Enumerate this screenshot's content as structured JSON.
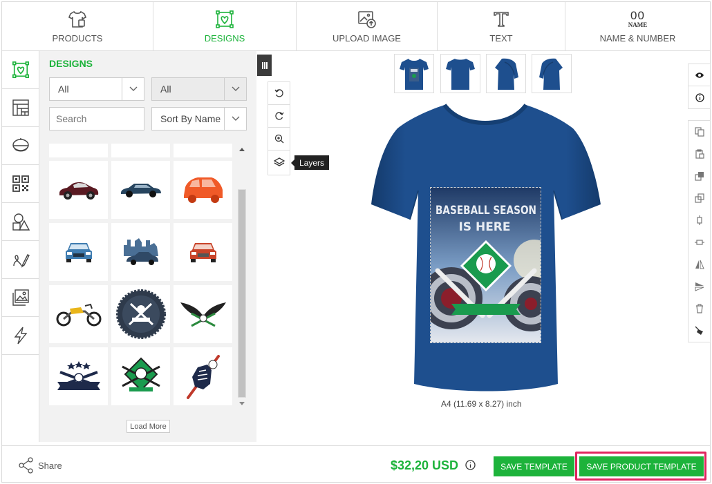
{
  "nav": {
    "tabs": [
      {
        "label": "PRODUCTS",
        "icon": "tshirt-icon"
      },
      {
        "label": "DESIGNS",
        "icon": "designs-icon",
        "active": true
      },
      {
        "label": "UPLOAD IMAGE",
        "icon": "upload-image-icon"
      },
      {
        "label": "TEXT",
        "icon": "text-icon"
      },
      {
        "label": "NAME & NUMBER",
        "icon": "name-number-icon",
        "icon_text": "00",
        "icon_sub": "NAME"
      }
    ]
  },
  "rail": {
    "items": [
      "designs-icon",
      "pattern-icon",
      "cap-icon",
      "qr-code-icon",
      "shapes-icon",
      "draw-icon",
      "image-icon",
      "lightning-icon"
    ]
  },
  "designs": {
    "title": "DESIGNS",
    "filter1": "All",
    "filter2": "All",
    "search_placeholder": "Search",
    "sort": "Sort By Name",
    "load_more": "Load More"
  },
  "tools": {
    "items": [
      "undo-icon",
      "redo-icon",
      "zoom-icon",
      "layers-icon"
    ],
    "tooltip": "Layers"
  },
  "canvas": {
    "design_line1": "BASEBALL SEASON",
    "design_line2": "IS HERE",
    "size_label": "A4 (11.69 x 8.27) inch",
    "shirt_color": "#1e4f8e"
  },
  "footer": {
    "share": "Share",
    "price": "$32,20 USD",
    "save_template": "SAVE TEMPLATE",
    "save_product_template": "SAVE PRODUCT TEMPLATE"
  },
  "colors": {
    "accent": "#1db33b",
    "highlight": "#e0245e"
  }
}
